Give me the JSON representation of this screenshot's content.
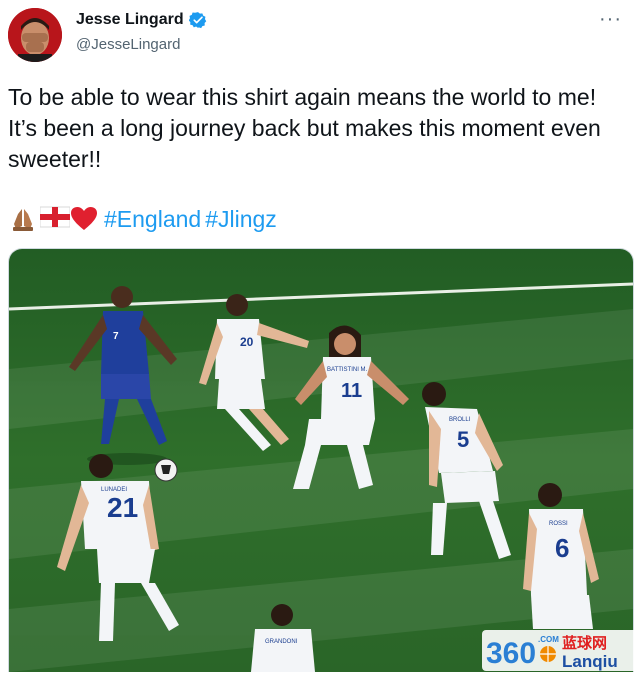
{
  "author": {
    "display_name": "Jesse Lingard",
    "handle": "@JesseLingard",
    "verified": true,
    "avatar_icon": "avatar-photo"
  },
  "tweet": {
    "text": "To be able to wear this shirt again means the world to me! It’s been a long journey back but makes this moment even sweeter!!",
    "emojis": [
      "folded-hands-icon",
      "england-flag-icon",
      "red-heart-icon"
    ],
    "hashtags": [
      "#England",
      "#Jlingz"
    ]
  },
  "media": {
    "players": [
      {
        "number": "7",
        "name": ""
      },
      {
        "number": "20",
        "name": ""
      },
      {
        "number": "11",
        "name": "BATTISTINI M."
      },
      {
        "number": "5",
        "name": "BROLLI"
      },
      {
        "number": "21",
        "name": "LUNADEI"
      },
      {
        "number": "6",
        "name": "ROSSI"
      },
      {
        "number": "",
        "name": "GRANDONI"
      }
    ]
  },
  "watermark": {
    "number": "360",
    "domain": ".COM",
    "cn_text": "蓝球网",
    "en_text": "Lanqiu"
  },
  "colors": {
    "hashtag": "#1d9bf0",
    "handle": "#536471",
    "pitch": "#2f6b2a",
    "england_kit": "#1f3f9c",
    "san_marino_kit": "#f3f5f8"
  }
}
